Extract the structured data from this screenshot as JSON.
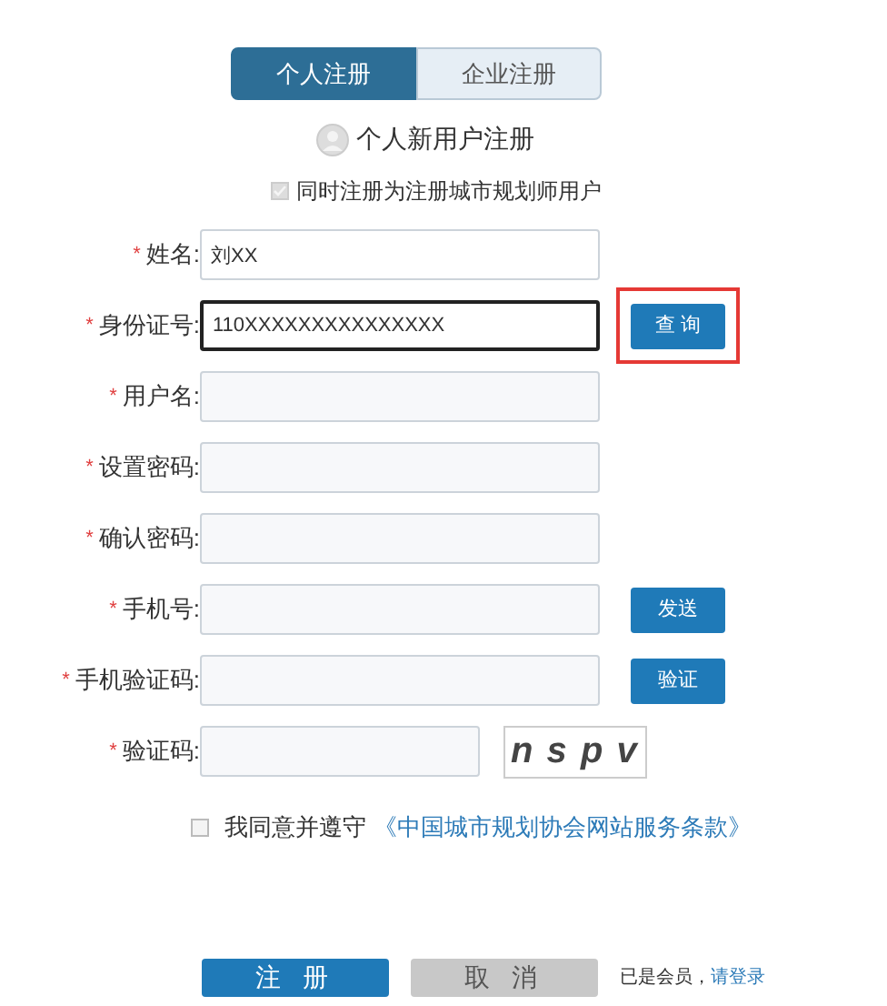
{
  "tabs": [
    {
      "label": "个人注册",
      "selected": true
    },
    {
      "label": "企业注册",
      "selected": false
    }
  ],
  "heading": "个人新用户注册",
  "planner_option": {
    "label": "同时注册为注册城市规划师用户",
    "checked": true,
    "disabled": true
  },
  "fields": [
    {
      "mark": "*",
      "label": "姓名:",
      "value": "刘XX",
      "focused": false
    },
    {
      "mark": "*",
      "label": "身份证号:",
      "value": "110XXXXXXXXXXXXXXX",
      "focused": true,
      "action": {
        "kind": "button",
        "label": "查 询",
        "highlighted": true
      }
    },
    {
      "mark": "*",
      "label": "用户名:",
      "focused": false
    },
    {
      "mark": "*",
      "label": "设置密码:",
      "focused": false
    },
    {
      "mark": "*",
      "label": "确认密码:",
      "focused": false
    },
    {
      "mark": "*",
      "label": "手机号:",
      "focused": false,
      "action": {
        "kind": "button",
        "label": "发送",
        "highlighted": false
      }
    },
    {
      "mark": "*",
      "label": "手机验证码:",
      "focused": false,
      "action": {
        "kind": "button",
        "label": "验证",
        "highlighted": false
      }
    },
    {
      "mark": "*",
      "label": "验证码:",
      "focused": false,
      "action": {
        "kind": "captcha",
        "label": "n s p v"
      }
    }
  ],
  "agreement": {
    "checked": false,
    "text": "我同意并遵守",
    "link": "《中国城市规划协会网站服务条款》"
  },
  "buttons": [
    {
      "label": "注 册",
      "disabled": false
    },
    {
      "label": "取 消",
      "disabled": true
    }
  ],
  "login_prompt": {
    "text": "已是会员，",
    "link": "请登录"
  }
}
